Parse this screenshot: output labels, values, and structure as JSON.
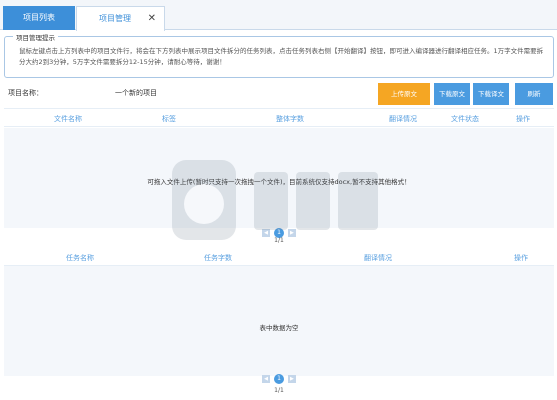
{
  "tabs": {
    "list_label": "项目列表",
    "manage_label": "项目管理",
    "close_glyph": "✕"
  },
  "hint": {
    "legend": "项目管理提示",
    "text": "鼠标左键点击上方列表中的项目文件行，将会在下方列表中展示项目文件拆分的任务列表，点击任务列表右侧【开始翻译】按钮，即可进入编译器进行翻译相应任务。1万字文件需要拆分大约2到3分钟，5万字文件需要拆分12-15分钟，请耐心等待，谢谢！"
  },
  "project": {
    "name_label": "项目名称：",
    "name_value": "一个新的项目"
  },
  "buttons": {
    "upload": "上传原文",
    "download_source": "下载原文",
    "download_translation": "下载译文",
    "refresh": "刷新"
  },
  "file_table": {
    "columns": [
      "文件名称",
      "标签",
      "整体字数",
      "翻译情况",
      "文件状态",
      "操作"
    ],
    "empty_text": "可拖入文件上传(暂时只支持一次拖拽一个文件)，目前系统仅支持docx,暂不支持其他格式！",
    "page_current": "1",
    "page_info": "1/1"
  },
  "task_table": {
    "columns": [
      "任务名称",
      "任务字数",
      "翻译情况",
      "操作"
    ],
    "empty_text": "表中数据为空",
    "page_current": "1",
    "page_info": "1/1"
  },
  "colors": {
    "accent_blue": "#3d8fd9",
    "upload_orange": "#f5a623",
    "header_text": "#5aa0e0"
  }
}
